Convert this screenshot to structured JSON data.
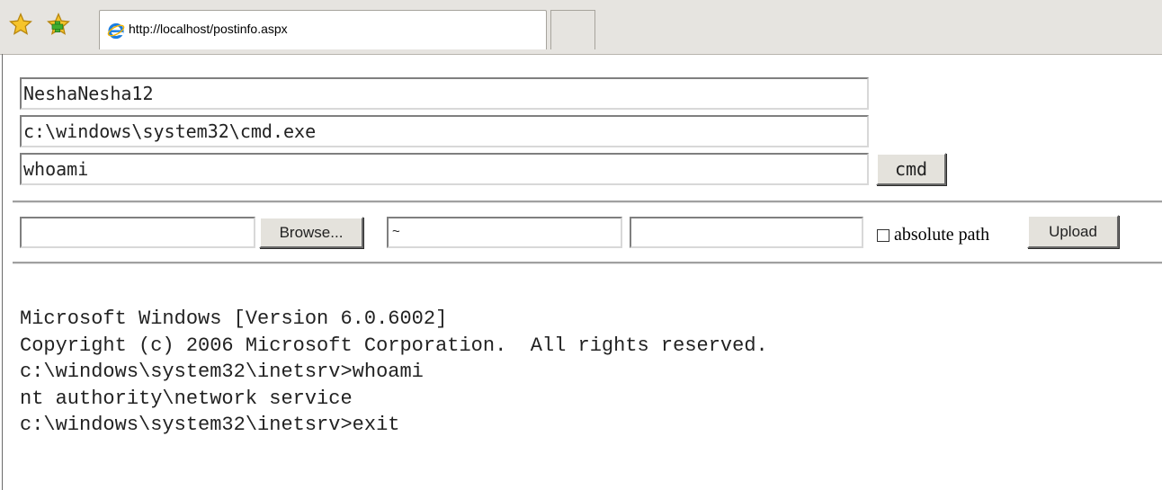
{
  "browser": {
    "tab_title": "http://localhost/postinfo.aspx",
    "icons": [
      "favorites-star-icon",
      "add-favorites-icon",
      "ie-page-icon"
    ]
  },
  "form": {
    "password_value": "NeshaNesha12",
    "program_value": "c:\\windows\\system32\\cmd.exe",
    "command_value": "whoami",
    "cmd_button_label": "cmd"
  },
  "upload": {
    "file_value": "",
    "browse_label": "Browse...",
    "dir_value": "~",
    "name_value": "",
    "absolute_path_label": "absolute path",
    "absolute_path_checked": false,
    "upload_label": "Upload"
  },
  "output": {
    "lines": [
      "Microsoft Windows [Version 6.0.6002]",
      "Copyright (c) 2006 Microsoft Corporation.  All rights reserved.",
      "c:\\windows\\system32\\inetsrv>whoami",
      "nt authority\\network service",
      "c:\\windows\\system32\\inetsrv>exit"
    ]
  }
}
